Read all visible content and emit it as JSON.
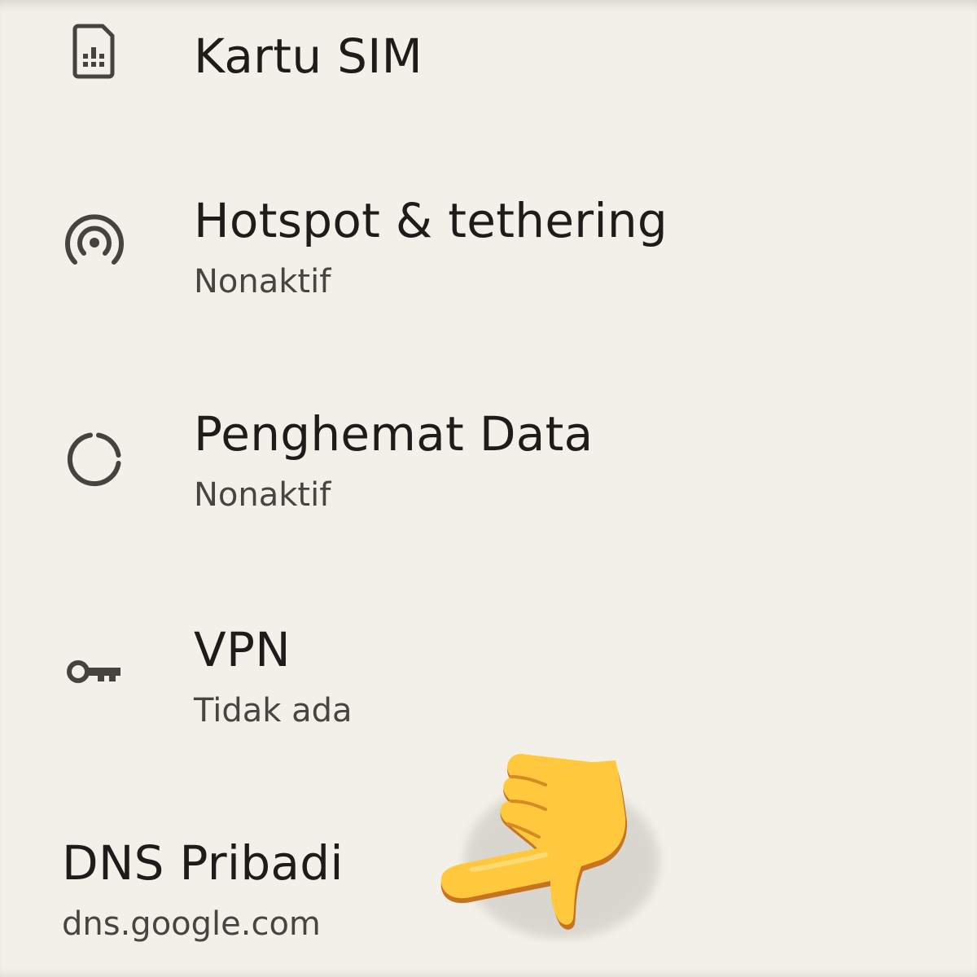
{
  "settings": {
    "items": [
      {
        "title": "Kartu SIM",
        "summary": "",
        "icon": "sim-card-icon"
      },
      {
        "title": "Hotspot & tethering",
        "summary": "Nonaktif",
        "icon": "hotspot-icon"
      },
      {
        "title": "Penghemat Data",
        "summary": "Nonaktif",
        "icon": "data-saver-icon"
      },
      {
        "title": "VPN",
        "summary": "Tidak ada",
        "icon": "vpn-key-icon"
      },
      {
        "title": "DNS Pribadi",
        "summary": "dns.google.com",
        "icon": ""
      }
    ]
  },
  "overlay": {
    "pointer_emoji": "backhand-index-pointing-left-icon"
  },
  "colors": {
    "background": "#f3f0e9",
    "title_text": "#1d1c1a",
    "summary_text": "#47453f",
    "icon": "#454340",
    "emoji_fill": "#ffc83d",
    "emoji_shadow": "#c8741f"
  }
}
